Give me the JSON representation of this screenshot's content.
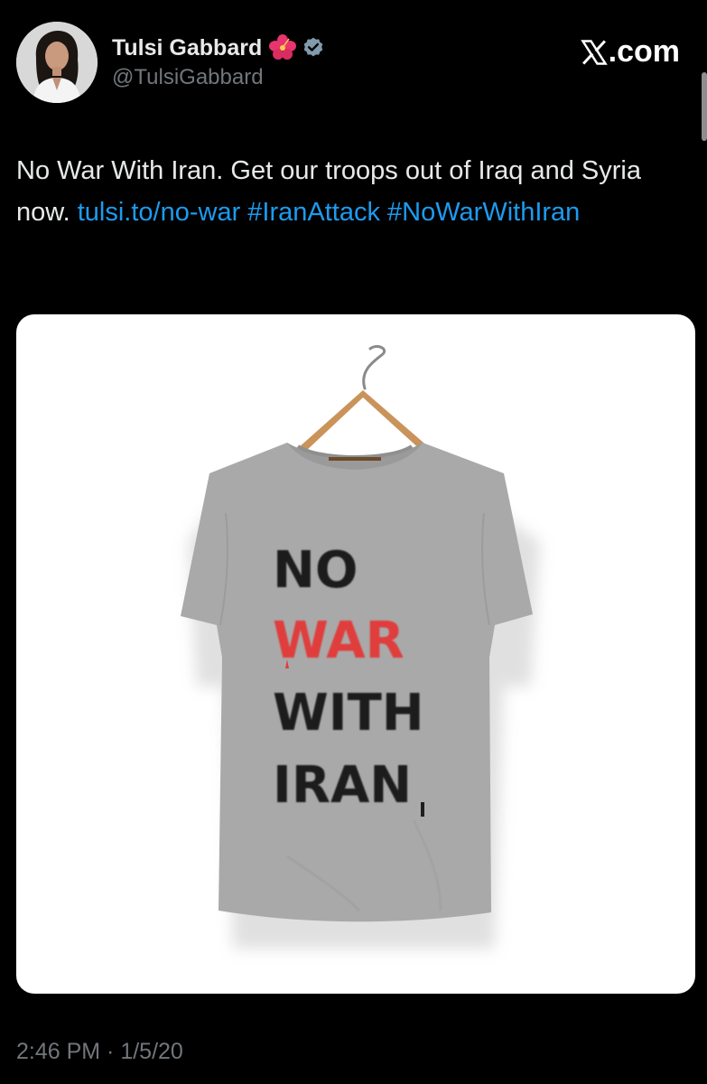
{
  "author": {
    "display_name": "Tulsi Gabbard",
    "handle": "@TulsiGabbard",
    "emoji_icon": "hibiscus-icon",
    "verified_icon": "verified-badge-icon"
  },
  "brand": {
    "label": ".com",
    "logo_icon": "x-logo-icon"
  },
  "tweet": {
    "text_part1": "No War With Iran. Get our troops out of Iraq and Syria now. ",
    "link": "tulsi.to/no-war",
    "space1": " ",
    "hashtag1": "#IranAttack",
    "space2": " ",
    "hashtag2": "#NoWarWithIran"
  },
  "media": {
    "shirt_lines": [
      "NO",
      "WAR",
      "WITH",
      "IRAN"
    ]
  },
  "timestamp": {
    "time": "2:46 PM",
    "separator": " · ",
    "date": "1/5/20"
  },
  "colors": {
    "background": "#000000",
    "text": "#e7e9ea",
    "secondary_text": "#71767b",
    "link": "#1d9bf0",
    "verified": "#829aab",
    "shirt": "#a9a9a9",
    "shirt_red": "#e03c3c"
  }
}
